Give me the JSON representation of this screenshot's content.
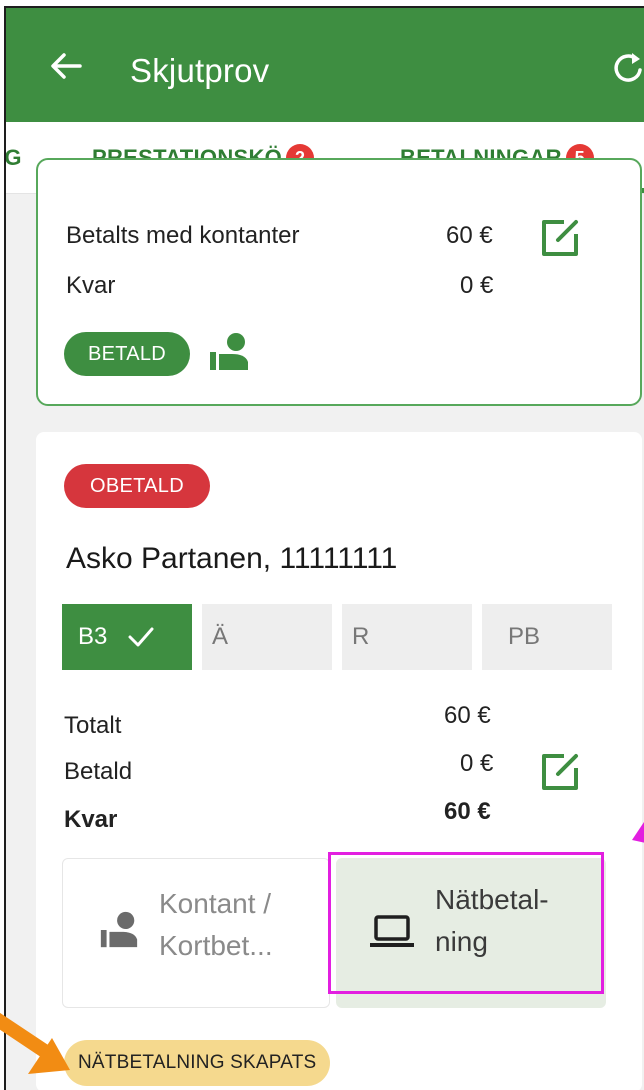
{
  "appbar": {
    "title": "Skjutprov",
    "back_icon": "arrow-left-icon",
    "refresh_icon": "refresh-icon"
  },
  "tabs": [
    {
      "label": "IG"
    },
    {
      "label": "PRESTATIONSKÖ",
      "badge": "2"
    },
    {
      "label": "BETALNINGAR",
      "badge": "5",
      "active": true
    }
  ],
  "card1": {
    "rows": [
      {
        "label": "Betalts med kontanter",
        "value": "60 €"
      },
      {
        "label": "Kvar",
        "value": "0 €"
      }
    ],
    "status": "BETALD"
  },
  "card2": {
    "status": "OBETALD",
    "name": "Asko Partanen, 11111111",
    "chips": [
      {
        "label": "B3",
        "active": true
      },
      {
        "label": "Ä"
      },
      {
        "label": "R"
      },
      {
        "label": "PB"
      }
    ],
    "totals": [
      {
        "label": "Totalt",
        "value": "60 €"
      },
      {
        "label": "Betald",
        "value": "0 €"
      },
      {
        "label": "Kvar",
        "value": "60 €",
        "bold": true
      }
    ],
    "pay_cash": {
      "line1": "Kontant /",
      "line2": "Kortbet..."
    },
    "pay_online": {
      "line1": "Nätbetal-",
      "line2": "ning"
    },
    "note": "NÄTBETALNING SKAPATS"
  },
  "colors": {
    "primary": "#3e8e41",
    "badge": "#e53935",
    "unpaid": "#d6363d",
    "note": "#f5d98e",
    "highlight": "#e21fe0",
    "arrow": "#f28c13"
  }
}
